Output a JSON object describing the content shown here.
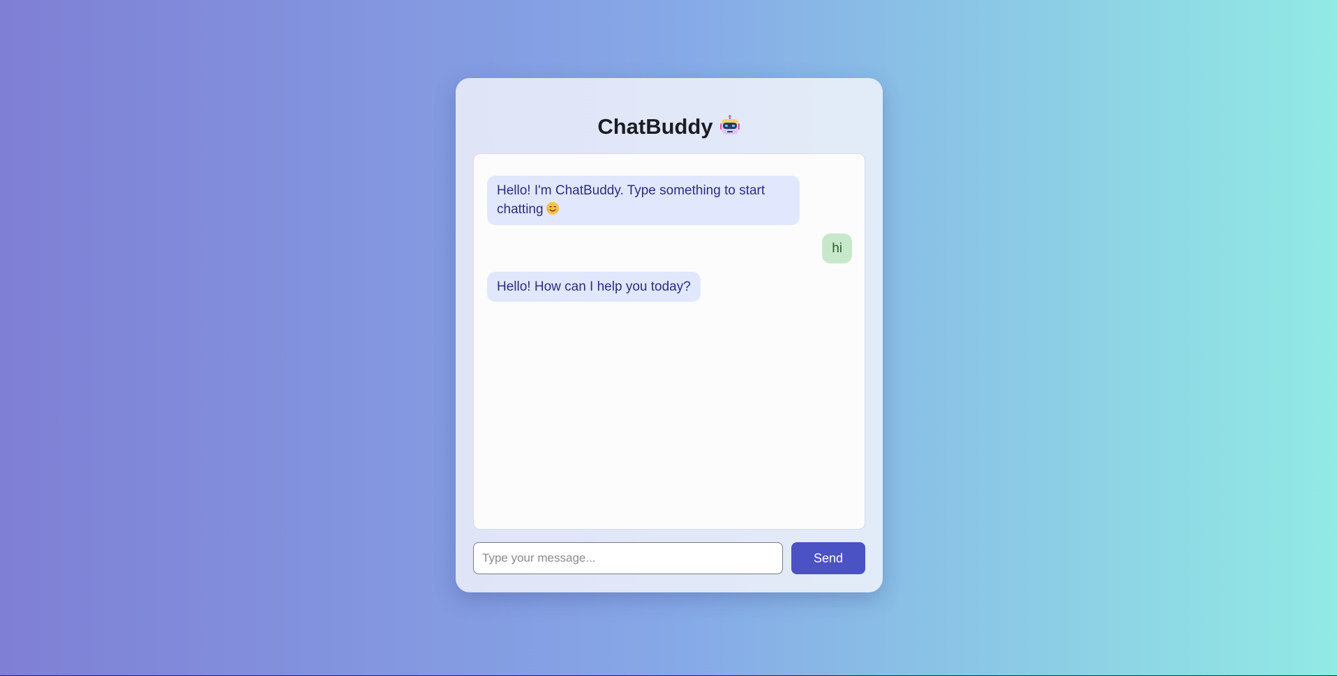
{
  "app": {
    "title": "ChatBuddy",
    "title_icon": "robot-icon"
  },
  "messages": [
    {
      "sender": "bot",
      "text": "Hello! I'm ChatBuddy. Type something to start chatting",
      "emoji": "smiling-face-icon"
    },
    {
      "sender": "user",
      "text": "hi"
    },
    {
      "sender": "bot",
      "text": "Hello! How can I help you today?"
    }
  ],
  "composer": {
    "placeholder": "Type your message...",
    "value": "",
    "send_label": "Send"
  },
  "colors": {
    "accent": "#4b52c4",
    "bot_bubble": "#e1e7fd",
    "user_bubble": "#c8e8cb",
    "background_start": "#7f7fd5",
    "background_end": "#91eae4"
  }
}
